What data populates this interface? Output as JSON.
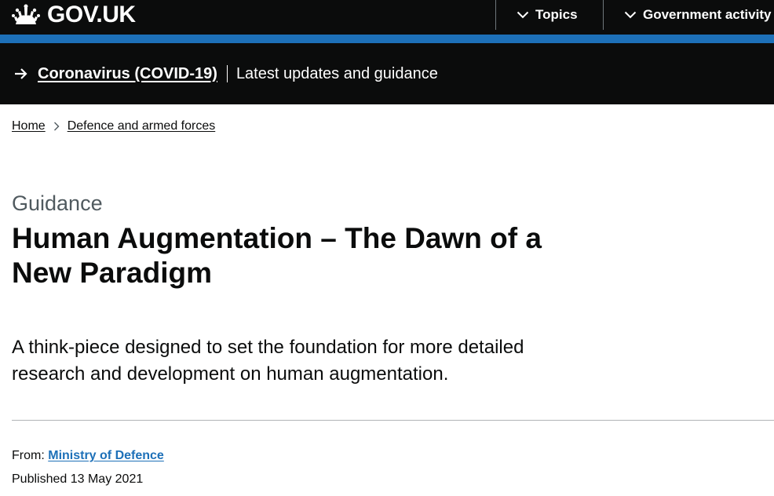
{
  "header": {
    "logo_text": "GOV.UK",
    "nav": [
      {
        "label": "Topics"
      },
      {
        "label": "Government activity"
      }
    ]
  },
  "banner": {
    "link_text": "Coronavirus (COVID-19)",
    "subtitle": "Latest updates and guidance"
  },
  "breadcrumb": [
    {
      "label": "Home"
    },
    {
      "label": "Defence and armed forces"
    }
  ],
  "page": {
    "caption": "Guidance",
    "title": "Human Augmentation – The Dawn of a New Paradigm",
    "lead": "A think-piece designed to set the foundation for more detailed research and development on human augmentation."
  },
  "metadata": {
    "from_label": "From:",
    "from_org": "Ministry of Defence",
    "published_label": "Published",
    "published_date": "13 May 2021"
  },
  "colors": {
    "header_bg": "#0b0c0c",
    "brand_blue": "#1d70b8",
    "caption_grey": "#505a5f"
  }
}
